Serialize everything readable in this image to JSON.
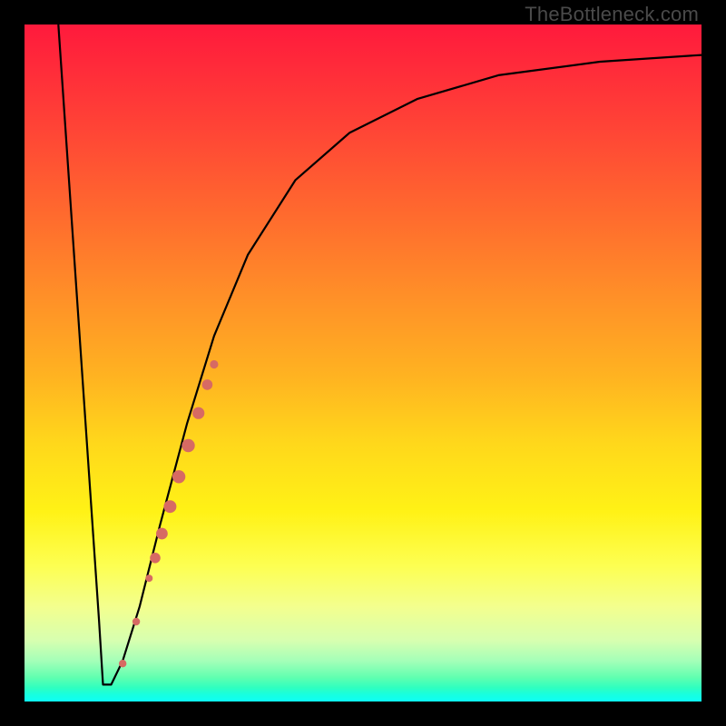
{
  "watermark": "TheBottleneck.com",
  "chart_data": {
    "type": "line",
    "title": "",
    "xlabel": "",
    "ylabel": "",
    "xlim": [
      0,
      100
    ],
    "ylim": [
      0,
      100
    ],
    "grid": false,
    "curve_estimated": [
      {
        "x": 5.0,
        "y": 100
      },
      {
        "x": 6.5,
        "y": 78
      },
      {
        "x": 8.0,
        "y": 56
      },
      {
        "x": 9.5,
        "y": 34
      },
      {
        "x": 11.0,
        "y": 12
      },
      {
        "x": 11.6,
        "y": 2.5
      },
      {
        "x": 12.8,
        "y": 2.5
      },
      {
        "x": 14.5,
        "y": 6
      },
      {
        "x": 17.0,
        "y": 14
      },
      {
        "x": 20.0,
        "y": 26
      },
      {
        "x": 24.0,
        "y": 41
      },
      {
        "x": 28.0,
        "y": 54
      },
      {
        "x": 33.0,
        "y": 66
      },
      {
        "x": 40.0,
        "y": 77
      },
      {
        "x": 48.0,
        "y": 84
      },
      {
        "x": 58.0,
        "y": 89
      },
      {
        "x": 70.0,
        "y": 92.5
      },
      {
        "x": 85.0,
        "y": 94.5
      },
      {
        "x": 100.0,
        "y": 95.5
      }
    ],
    "markers_estimated": [
      {
        "x": 14.5,
        "y": 5.6,
        "r": 4.2
      },
      {
        "x": 16.5,
        "y": 11.8,
        "r": 4.2
      },
      {
        "x": 18.4,
        "y": 18.2,
        "r": 4.0
      },
      {
        "x": 19.3,
        "y": 21.2,
        "r": 5.8
      },
      {
        "x": 20.3,
        "y": 24.8,
        "r": 6.4
      },
      {
        "x": 21.5,
        "y": 28.8,
        "r": 7.0
      },
      {
        "x": 22.8,
        "y": 33.2,
        "r": 7.2
      },
      {
        "x": 24.2,
        "y": 37.8,
        "r": 7.2
      },
      {
        "x": 25.7,
        "y": 42.6,
        "r": 6.6
      },
      {
        "x": 27.0,
        "y": 46.8,
        "r": 5.8
      },
      {
        "x": 28.0,
        "y": 49.8,
        "r": 4.6
      }
    ],
    "colors": {
      "curve": "#000000",
      "marker_fill": "#d76a63",
      "gradient_top": "#ff1a3c",
      "gradient_mid": "#fff216",
      "gradient_bottom": "#0dfff5"
    }
  }
}
